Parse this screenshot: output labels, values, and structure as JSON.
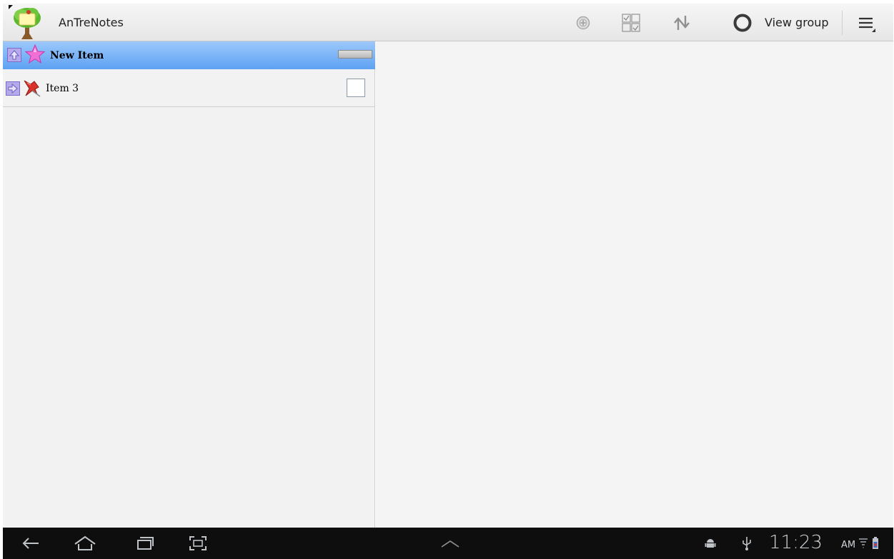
{
  "app": {
    "title": "AnTreNotes"
  },
  "toolbar": {
    "view_group_label": "View group",
    "icons": [
      "add-circle-icon",
      "checklist-grid-icon",
      "sort-arrows-icon",
      "view-group-ring-icon",
      "overflow-menu-icon"
    ]
  },
  "items": [
    {
      "label": "New Item",
      "selected": true,
      "move_icon": "move-up-icon",
      "type_icon": "star-icon",
      "control": "progress-bar"
    },
    {
      "label": "Item 3",
      "selected": false,
      "move_icon": "move-right-icon",
      "type_icon": "pushpin-icon",
      "control": "checkbox",
      "checked": false
    }
  ],
  "statusbar": {
    "time": "11:23",
    "ampm": "AM",
    "icons": [
      "back-icon",
      "home-icon",
      "recent-apps-icon",
      "screenshot-icon",
      "expand-up-icon",
      "android-debug-icon",
      "usb-icon",
      "wifi-icon",
      "battery-icon"
    ]
  },
  "colors": {
    "selection_top": "#9cc8fb",
    "selection_bottom": "#5ea2f3",
    "system_bar": "#0e0e0e"
  }
}
